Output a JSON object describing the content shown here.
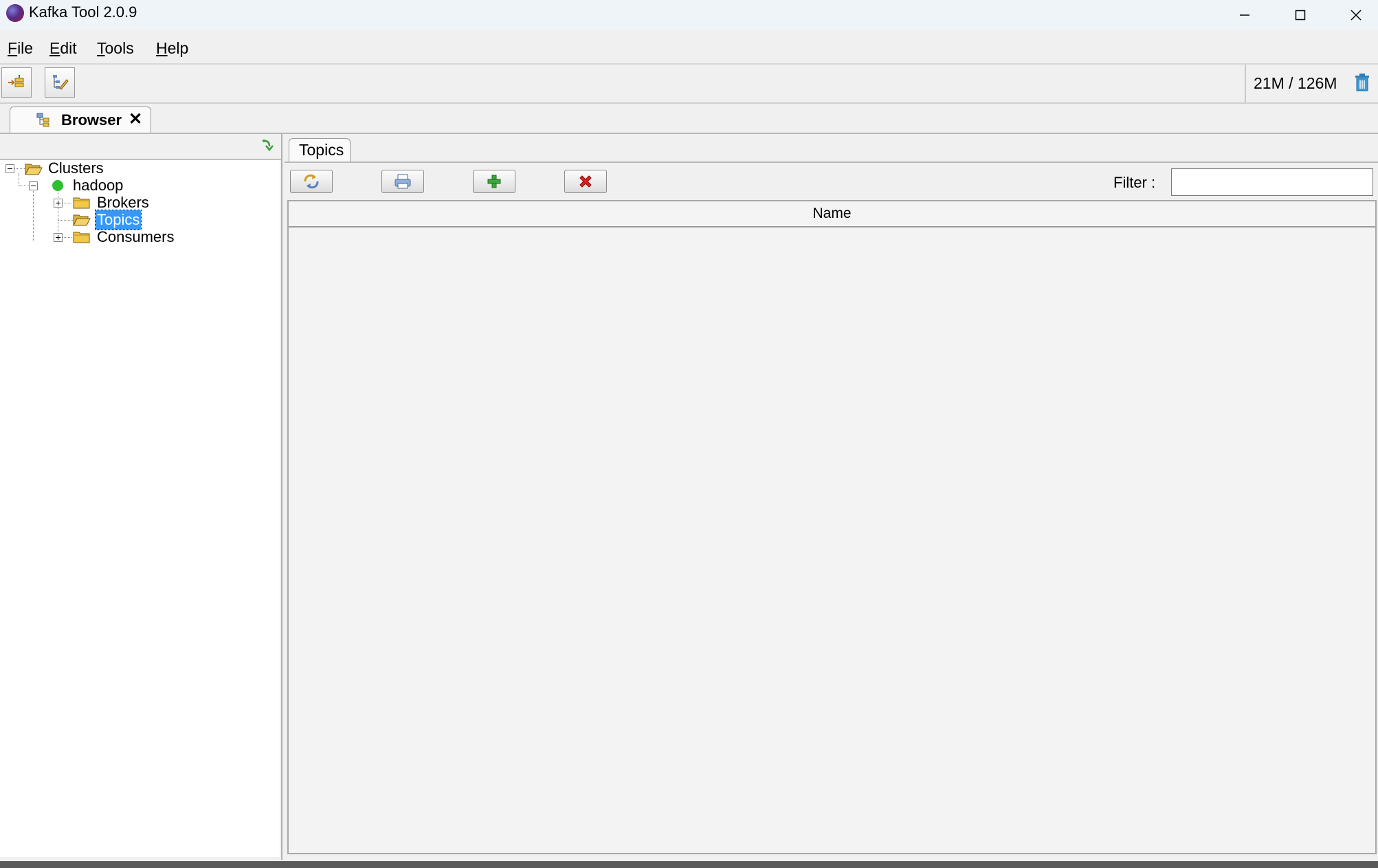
{
  "window": {
    "title": "Kafka Tool  2.0.9"
  },
  "menu": [
    {
      "label": "File",
      "mnemonic": "F",
      "rest": "ile"
    },
    {
      "label": "Edit",
      "mnemonic": "E",
      "rest": "dit"
    },
    {
      "label": "Tools",
      "mnemonic": "T",
      "rest": "ools"
    },
    {
      "label": "Help",
      "mnemonic": "H",
      "rest": "elp"
    }
  ],
  "toolbar": {
    "memory": "21M / 126M"
  },
  "tabs": {
    "browser": "Browser",
    "browser_close": "✕"
  },
  "tree": {
    "root": "Clusters",
    "cluster": "hadoop",
    "children": [
      "Brokers",
      "Topics",
      "Consumers"
    ],
    "selected": "Topics",
    "cluster_status_color": "#2fbf2f"
  },
  "topics_panel": {
    "tab": "Topics",
    "filter_label": "Filter :",
    "filter_value": "",
    "columns": [
      "Name"
    ],
    "rows": []
  }
}
